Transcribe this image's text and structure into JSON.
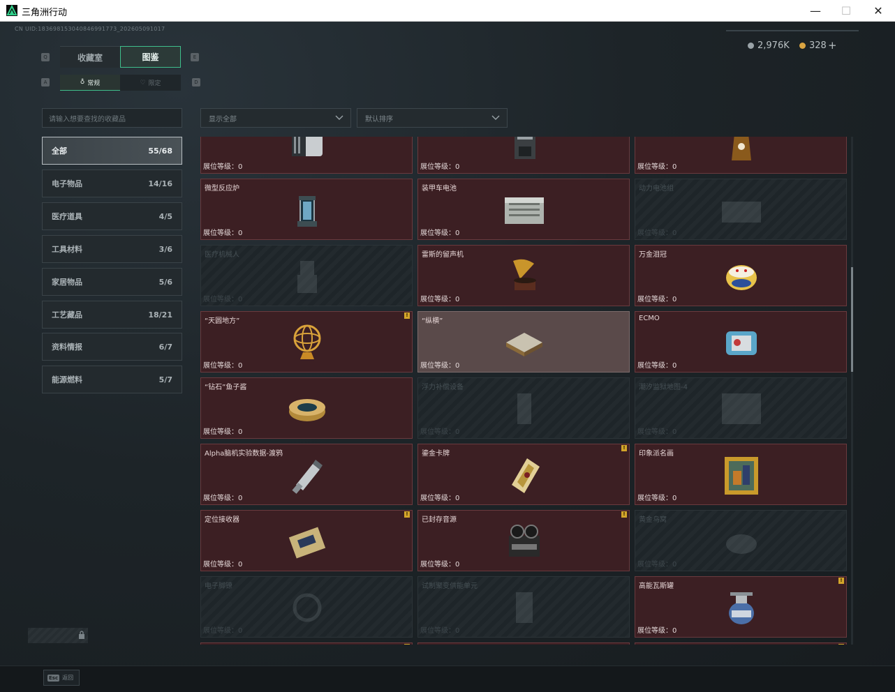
{
  "window": {
    "title": "三角洲行动",
    "minimize_glyph": "—",
    "maximize_glyph": "☐",
    "close_glyph": "✕"
  },
  "header": {
    "uid": "CN UID:183698153040846991773_202605091017",
    "currency_a": "2,976K",
    "currency_b": "328",
    "add_glyph": "+",
    "currency_a_color": "#9aa3a8",
    "currency_b_color": "#d9a441"
  },
  "tabs": {
    "main": [
      {
        "label": "收藏室"
      },
      {
        "label": "图鉴"
      }
    ],
    "sub": [
      {
        "label": "常规"
      },
      {
        "label": "限定"
      }
    ],
    "hint_left_main": "Q",
    "hint_right_main": "E",
    "hint_left_sub": "A",
    "hint_right_sub": "D"
  },
  "search": {
    "placeholder": "请输入想要查找的收藏品"
  },
  "filters": {
    "filter_value": "显示全部",
    "sort_value": "默认排序"
  },
  "categories": [
    {
      "label": "全部",
      "count": "55/68"
    },
    {
      "label": "电子物品",
      "count": "14/16"
    },
    {
      "label": "医疗道具",
      "count": "4/5"
    },
    {
      "label": "工具材料",
      "count": "3/6"
    },
    {
      "label": "家居物品",
      "count": "5/6"
    },
    {
      "label": "工艺藏品",
      "count": "18/21"
    },
    {
      "label": "资料情报",
      "count": "6/7"
    },
    {
      "label": "能源燃料",
      "count": "5/7"
    }
  ],
  "level_label": "展位等级：0",
  "cards": [
    {
      "name": "",
      "icon": "server-icon",
      "state": "owned",
      "badge": ""
    },
    {
      "name": "",
      "icon": "coffee-machine-icon",
      "state": "owned",
      "badge": ""
    },
    {
      "name": "",
      "icon": "bag-icon",
      "state": "owned",
      "badge": ""
    },
    {
      "name": "微型反应炉",
      "icon": "reactor-icon",
      "state": "owned",
      "badge": ""
    },
    {
      "name": "装甲车电池",
      "icon": "battery-icon",
      "state": "owned",
      "badge": ""
    },
    {
      "name": "动力电池组",
      "icon": "battery-pack-icon",
      "state": "locked",
      "badge": ""
    },
    {
      "name": "医疗机械人",
      "icon": "robot-icon",
      "state": "locked",
      "badge": ""
    },
    {
      "name": "雷斯的留声机",
      "icon": "gramophone-icon",
      "state": "owned",
      "badge": ""
    },
    {
      "name": "万金泪冠",
      "icon": "egg-crown-icon",
      "state": "owned",
      "badge": ""
    },
    {
      "name": "“天圆地方”",
      "icon": "armillary-icon",
      "state": "owned",
      "badge": "!"
    },
    {
      "name": "“纵横”",
      "icon": "chessboard-icon",
      "state": "highlight",
      "badge": ""
    },
    {
      "name": "ECMO",
      "icon": "ecmo-icon",
      "state": "owned",
      "badge": ""
    },
    {
      "name": "“钻石”鱼子酱",
      "icon": "caviar-tin-icon",
      "state": "owned",
      "badge": ""
    },
    {
      "name": "浮力补偿设备",
      "icon": "buoyancy-icon",
      "state": "locked",
      "badge": ""
    },
    {
      "name": "潮汐监狱地图-4",
      "icon": "map-icon",
      "state": "locked",
      "badge": ""
    },
    {
      "name": "Alpha脑机实验数据-渡鸦",
      "icon": "usb-drive-icon",
      "state": "owned",
      "badge": ""
    },
    {
      "name": "鎏金卡牌",
      "icon": "gold-card-icon",
      "state": "owned",
      "badge": "!"
    },
    {
      "name": "印象派名画",
      "icon": "painting-icon",
      "state": "owned",
      "badge": ""
    },
    {
      "name": "定位接收器",
      "icon": "receiver-icon",
      "state": "owned",
      "badge": "!"
    },
    {
      "name": "已封存音源",
      "icon": "tape-recorder-icon",
      "state": "owned",
      "badge": "!"
    },
    {
      "name": "黄金鸟窝",
      "icon": "nest-icon",
      "state": "locked",
      "badge": ""
    },
    {
      "name": "电子脚镣",
      "icon": "ankle-monitor-icon",
      "state": "locked",
      "badge": ""
    },
    {
      "name": "试制聚变供能单元",
      "icon": "fusion-cell-icon",
      "state": "locked",
      "badge": ""
    },
    {
      "name": "高能瓦斯罐",
      "icon": "gas-canister-icon",
      "state": "owned",
      "badge": "!"
    },
    {
      "name": "",
      "icon": "",
      "state": "owned",
      "badge": "!"
    },
    {
      "name": "",
      "icon": "",
      "state": "owned",
      "badge": ""
    },
    {
      "name": "",
      "icon": "",
      "state": "owned",
      "badge": "!"
    }
  ],
  "footer": {
    "esc_key": "Esc",
    "esc_label": "返回"
  }
}
